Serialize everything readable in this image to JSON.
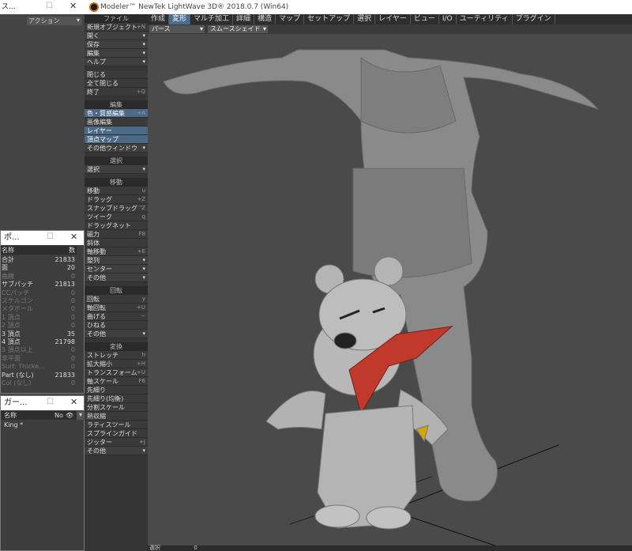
{
  "left_top_window": {
    "title": "ス...",
    "dropdown": "アクション"
  },
  "window": {
    "title": "Modeler™ NewTek LightWave 3D® 2018.0.7 (Win64)"
  },
  "tabs": [
    "作成",
    "変形",
    "マルチ加工",
    "詳細",
    "構造",
    "マップ",
    "セットアップ",
    "選択",
    "レイヤー",
    "ビュー",
    "I/O",
    "ユーティリティ",
    "プラグイン"
  ],
  "active_tab": "変形",
  "viewport": {
    "view_mode": "パース",
    "shading": "スムースシェイド"
  },
  "menu": {
    "file_header": "ファイル",
    "file_items": [
      {
        "label": "新規オブジェクト",
        "sc": "+N"
      },
      {
        "label": "開く",
        "arr": "▾"
      },
      {
        "label": "保存",
        "arr": "▾"
      },
      {
        "label": "編集",
        "arr": "▾"
      },
      {
        "label": "ヘルプ",
        "arr": "▾"
      }
    ],
    "file_items2": [
      {
        "label": "閉じる",
        "sc": ""
      },
      {
        "label": "全て閉じる",
        "sc": ""
      },
      {
        "label": "終了",
        "sc": "+Q"
      }
    ],
    "edit_header": "編集",
    "edit_items": [
      {
        "label": "色・質感編集",
        "sc": "+A"
      },
      {
        "label": "画像編集",
        "sc": ""
      },
      {
        "label": "レイヤー",
        "sc": ""
      },
      {
        "label": "頂点マップ",
        "sc": ""
      },
      {
        "label": "その他ウィンドウ",
        "arr": "▾"
      }
    ],
    "select_header": "選択",
    "select_items": [
      {
        "label": "選択",
        "arr": "▾"
      }
    ],
    "move_header": "移動",
    "move_items": [
      {
        "label": "移動",
        "sc": "u"
      },
      {
        "label": "ドラッグ",
        "sc": "+Z"
      },
      {
        "label": "スナップドラッグ",
        "sc": "\"Z"
      },
      {
        "label": "ツイーク",
        "sc": "q"
      },
      {
        "label": "ドラッグネット",
        "sc": ""
      },
      {
        "label": "磁力",
        "sc": "F8"
      },
      {
        "label": "斜体",
        "sc": ""
      },
      {
        "label": "軸移動",
        "sc": "+E"
      },
      {
        "label": "整列",
        "arr": "▾"
      },
      {
        "label": "センター",
        "arr": "▾"
      },
      {
        "label": "その他",
        "arr": "▾"
      }
    ],
    "rotate_header": "回転",
    "rotate_items": [
      {
        "label": "回転",
        "sc": "y"
      },
      {
        "label": "軸回転",
        "sc": "+U"
      },
      {
        "label": "曲げる",
        "sc": "~"
      },
      {
        "label": "ひねる",
        "sc": ""
      },
      {
        "label": "その他",
        "arr": "▾"
      }
    ],
    "transform_header": "変換",
    "transform_items": [
      {
        "label": "ストレッチ",
        "sc": "h"
      },
      {
        "label": "拡大縮小",
        "sc": "+H"
      },
      {
        "label": "トランスフォーム",
        "sc": "+U"
      },
      {
        "label": "軸スケール",
        "sc": "F6"
      },
      {
        "label": "先細り",
        "sc": ""
      },
      {
        "label": "先細り(均衡)",
        "sc": ""
      },
      {
        "label": "分割スケール",
        "sc": ""
      },
      {
        "label": "熱収縮",
        "sc": ""
      },
      {
        "label": "ラティスツール",
        "sc": ""
      },
      {
        "label": "スプラインガイド",
        "sc": ""
      },
      {
        "label": "ジッター",
        "sc": "+J"
      },
      {
        "label": "その他",
        "arr": "▾"
      }
    ]
  },
  "stats": {
    "title": "ポ...",
    "col_name": "名称",
    "col_count": "数",
    "rows": [
      {
        "k": "合計",
        "v": "21833",
        "dim": false
      },
      {
        "k": "面",
        "v": "20",
        "dim": false
      },
      {
        "k": "曲線",
        "v": "0",
        "dim": true
      },
      {
        "k": "サブパッチ",
        "v": "21813",
        "dim": false
      },
      {
        "k": "CCパッチ",
        "v": "0",
        "dim": true
      },
      {
        "k": "スケルゴン",
        "v": "0",
        "dim": true
      },
      {
        "k": "メタボール",
        "v": "0",
        "dim": true
      },
      {
        "k": "1 頂点",
        "v": "0",
        "dim": true
      },
      {
        "k": "2 頂点",
        "v": "0",
        "dim": true
      },
      {
        "k": "3 頂点",
        "v": "35",
        "dim": false
      },
      {
        "k": "4 頂点",
        "v": "21798",
        "dim": false
      },
      {
        "k": "5 頂点以上",
        "v": "0",
        "dim": true
      },
      {
        "k": "非平面",
        "v": "0",
        "dim": true
      },
      {
        "k": "Surf: Thicke...",
        "v": "0",
        "dim": true
      },
      {
        "k": "Part (なし)",
        "v": "21833",
        "dim": false
      },
      {
        "k": "Col (なし)",
        "v": "0",
        "dim": true
      }
    ]
  },
  "layers": {
    "title": "ガー...",
    "col_name": "名称",
    "col_no": "No",
    "rows": [
      {
        "name": "King *"
      }
    ]
  },
  "status": {
    "label": "選択",
    "value": "0"
  }
}
